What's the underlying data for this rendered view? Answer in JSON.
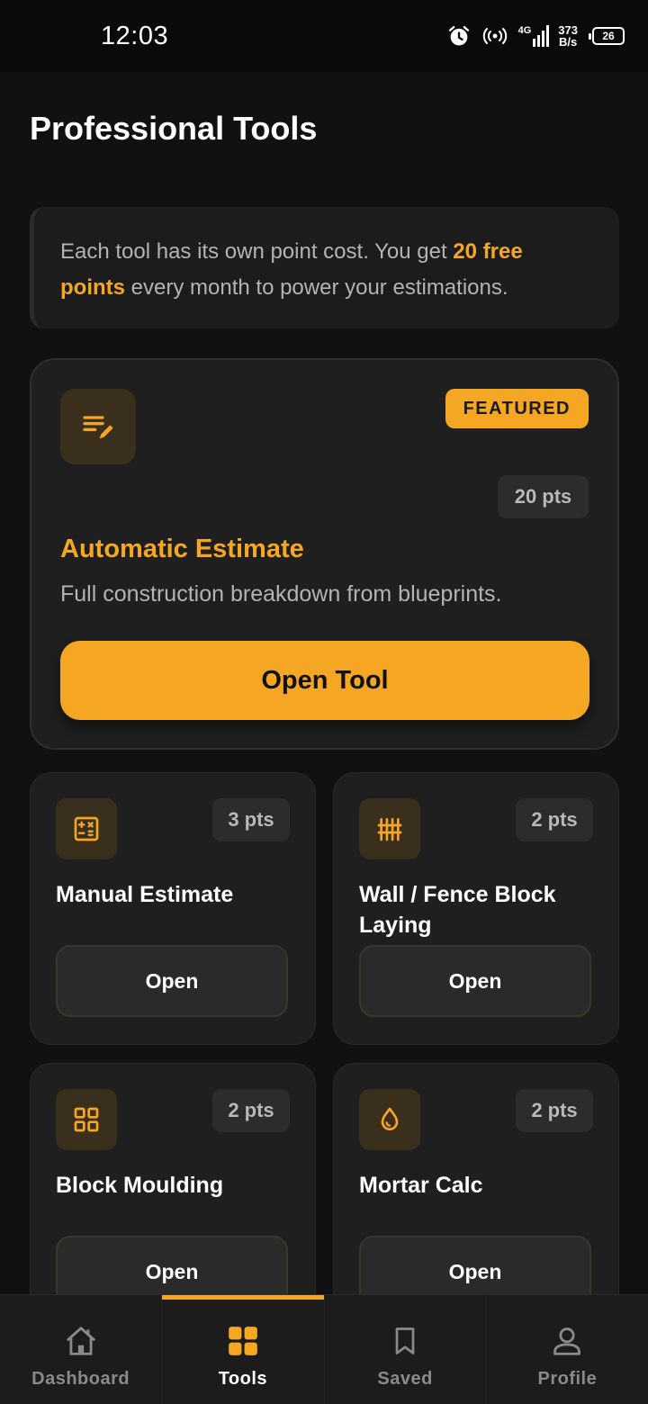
{
  "status_bar": {
    "time": "12:03",
    "network_type": "4G",
    "speed_value": "373",
    "speed_unit": "B/s",
    "battery": "26"
  },
  "page": {
    "title": "Professional Tools"
  },
  "info": {
    "text_before": "Each tool has its own point cost. You get ",
    "highlight": "20 free points",
    "text_after": " every month to power your estimations."
  },
  "featured": {
    "icon": "edit-note-icon",
    "badge": "FEATURED",
    "points": "20 pts",
    "title": "Automatic Estimate",
    "description": "Full construction breakdown from blueprints.",
    "button_label": "Open Tool"
  },
  "tools": [
    {
      "icon": "calculator-icon",
      "points": "3 pts",
      "title": "Manual Estimate",
      "button_label": "Open"
    },
    {
      "icon": "fence-icon",
      "points": "2 pts",
      "title": "Wall / Fence Block Laying",
      "button_label": "Open"
    },
    {
      "icon": "grid-icon",
      "points": "2 pts",
      "title": "Block Moulding",
      "button_label": "Open"
    },
    {
      "icon": "water-drop-icon",
      "points": "2 pts",
      "title": "Mortar Calc",
      "button_label": "Open"
    }
  ],
  "bottom_nav": [
    {
      "icon": "home-icon",
      "label": "Dashboard",
      "active": false
    },
    {
      "icon": "grid-icon",
      "label": "Tools",
      "active": true
    },
    {
      "icon": "bookmark-icon",
      "label": "Saved",
      "active": false
    },
    {
      "icon": "person-icon",
      "label": "Profile",
      "active": false
    }
  ],
  "colors": {
    "accent": "#f5a623",
    "background": "#111111",
    "card": "#1f1f1f"
  }
}
